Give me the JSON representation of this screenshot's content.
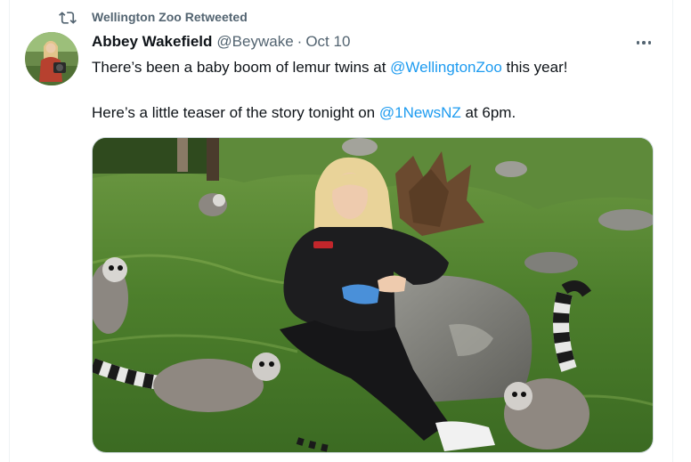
{
  "retweet": {
    "label": "Wellington Zoo Retweeted",
    "icon": "retweet-icon"
  },
  "author": {
    "name": "Abbey Wakefield",
    "handle": "@Beywake",
    "separator": "·",
    "date": "Oct 10"
  },
  "tweet": {
    "line1_prefix": "There’s been a baby boom of lemur twins at ",
    "line1_mention": "@WellingtonZoo",
    "line1_suffix": " this year!",
    "line2_prefix": "Here’s a little teaser of the story tonight on ",
    "line2_mention": "@1NewsNZ",
    "line2_suffix": " at 6pm."
  },
  "colors": {
    "link": "#1d9bf0",
    "secondary_text": "#536471",
    "primary_text": "#0f1419"
  },
  "media": {
    "icon": "video-still-image"
  }
}
